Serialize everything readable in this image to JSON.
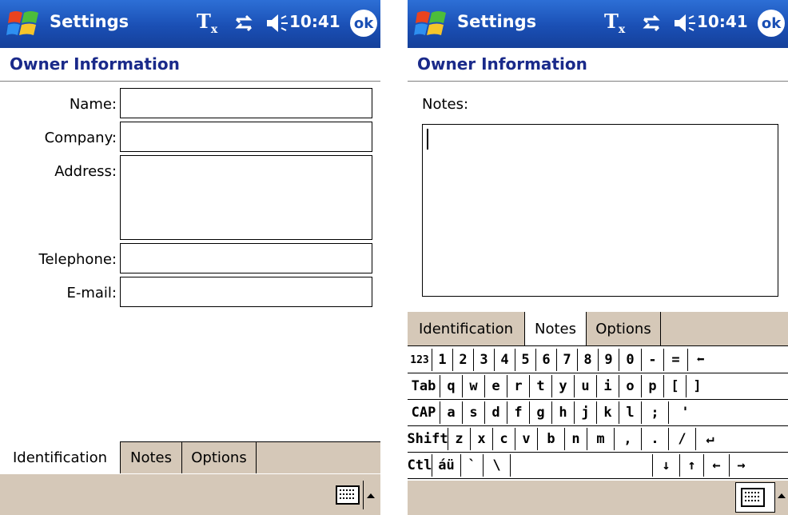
{
  "status_bar": {
    "title": "Settings",
    "clock": "10:41",
    "ok_label": "ok",
    "tx_label": "T",
    "tx_sub": "x"
  },
  "page": {
    "heading": "Owner Information"
  },
  "identification_form": {
    "fields": [
      {
        "label": "Name:",
        "value": ""
      },
      {
        "label": "Company:",
        "value": ""
      },
      {
        "label": "Address:",
        "value": ""
      },
      {
        "label": "Telephone:",
        "value": ""
      },
      {
        "label": "E-mail:",
        "value": ""
      }
    ]
  },
  "notes_form": {
    "label": "Notes:",
    "value": ""
  },
  "tabs": [
    {
      "label": "Identification"
    },
    {
      "label": "Notes"
    },
    {
      "label": "Options"
    }
  ],
  "left_active_tab": "Identification",
  "right_active_tab": "Notes",
  "keyboard": {
    "rows": [
      [
        "123",
        "1",
        "2",
        "3",
        "4",
        "5",
        "6",
        "7",
        "8",
        "9",
        "0",
        "-",
        "=",
        "⬅"
      ],
      [
        "Tab",
        "q",
        "w",
        "e",
        "r",
        "t",
        "y",
        "u",
        "i",
        "o",
        "p",
        "[",
        "]"
      ],
      [
        "CAP",
        "a",
        "s",
        "d",
        "f",
        "g",
        "h",
        "j",
        "k",
        "l",
        ";",
        "'"
      ],
      [
        "Shift",
        "z",
        "x",
        "c",
        "v",
        "b",
        "n",
        "m",
        ",",
        ".",
        "/",
        "↵"
      ],
      [
        "Ctl",
        "áü",
        "`",
        "\\",
        "",
        "↓",
        "↑",
        "←",
        "→"
      ]
    ]
  },
  "icons": {
    "start": "windows-flag-icon",
    "connectivity": "connectivity-icon",
    "volume": "speaker-icon",
    "input_panel": "keyboard-icon"
  },
  "colors": {
    "titlebar": "#1a4fb4",
    "heading": "#1a2a8a",
    "panel": "#d5c8b8"
  }
}
